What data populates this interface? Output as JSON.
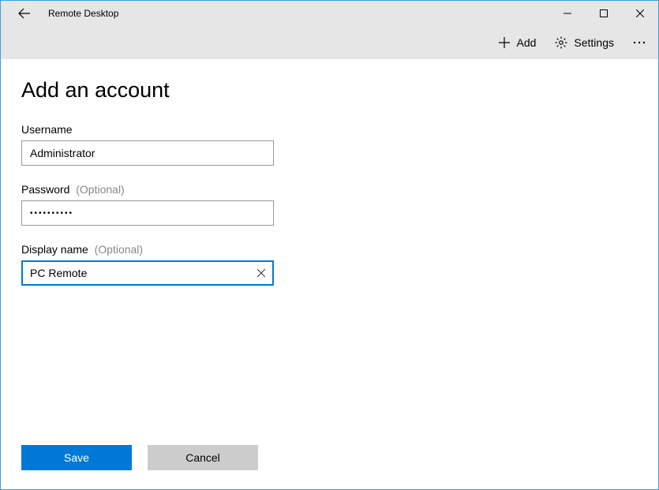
{
  "window": {
    "title": "Remote Desktop"
  },
  "commands": {
    "add": "Add",
    "settings": "Settings"
  },
  "page": {
    "title": "Add an account"
  },
  "fields": {
    "username": {
      "label": "Username",
      "value": "Administrator"
    },
    "password": {
      "label": "Password",
      "optional": "(Optional)",
      "value": "••••••••••"
    },
    "displayname": {
      "label": "Display name",
      "optional": "(Optional)",
      "value": "PC Remote"
    }
  },
  "buttons": {
    "save": "Save",
    "cancel": "Cancel"
  }
}
